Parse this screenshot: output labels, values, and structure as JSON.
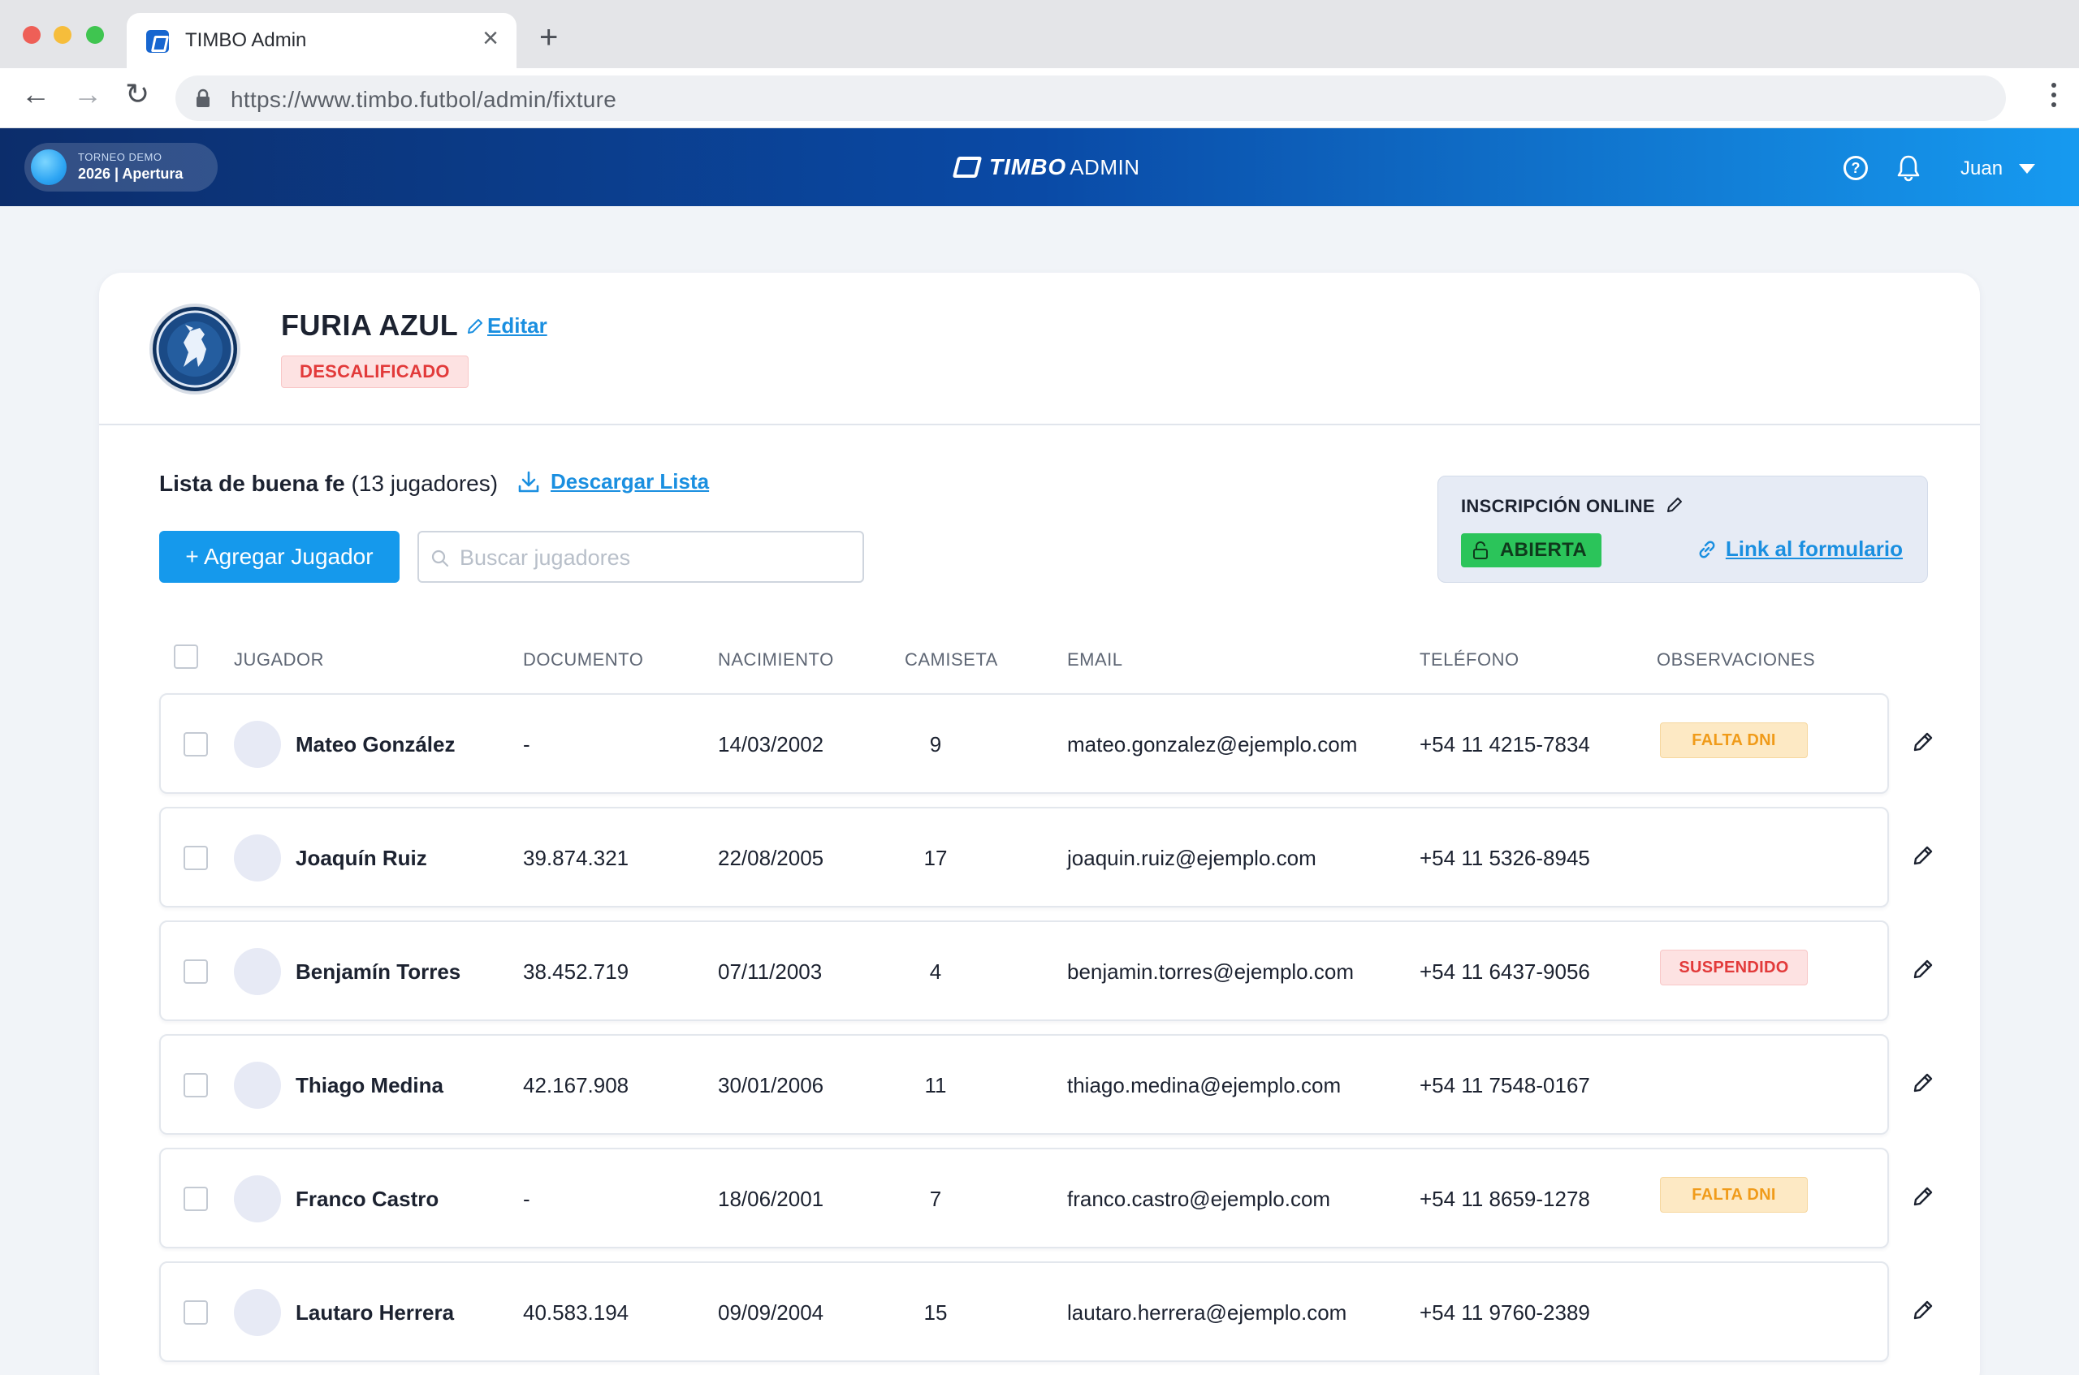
{
  "browser": {
    "tab_title": "TIMBO Admin",
    "url": "https://www.timbo.futbol/admin/fixture"
  },
  "header": {
    "season_small": "TORNEO DEMO",
    "season_main": "2026 | Apertura",
    "brand_name": "TIMBO",
    "brand_suffix": "ADMIN",
    "user_name": "Juan",
    "gradient": [
      "#0c2d6b",
      "#169af0"
    ]
  },
  "team": {
    "name": "FURIA AZUL",
    "edit_label": "Editar",
    "status": "DESCALIFICADO",
    "logo_text": "FURIA AZUL"
  },
  "list": {
    "title_bold": "Lista de buena fe",
    "title_count": "(13 jugadores)",
    "download_label": "Descargar Lista",
    "add_label": "+ Agregar Jugador",
    "search_placeholder": "Buscar jugadores"
  },
  "online": {
    "title": "INSCRIPCIÓN ONLINE",
    "state": "ABIERTA",
    "link_label": "Link al formulario"
  },
  "table": {
    "columns": [
      "JUGADOR",
      "DOCUMENTO",
      "NACIMIENTO",
      "CAMISETA",
      "EMAIL",
      "TELÉFONO",
      "OBSERVACIONES"
    ],
    "rows": [
      {
        "name": "Mateo González",
        "doc": "-",
        "birth": "14/03/2002",
        "shirt": "9",
        "email": "mateo.gonzalez@ejemplo.com",
        "phone": "+54 11 4215-7834",
        "obs": "FALTA DNI",
        "obs_type": "warning"
      },
      {
        "name": "Joaquín Ruiz",
        "doc": "39.874.321",
        "birth": "22/08/2005",
        "shirt": "17",
        "email": "joaquin.ruiz@ejemplo.com",
        "phone": "+54 11 5326-8945",
        "obs": "",
        "obs_type": ""
      },
      {
        "name": "Benjamín Torres",
        "doc": "38.452.719",
        "birth": "07/11/2003",
        "shirt": "4",
        "email": "benjamin.torres@ejemplo.com",
        "phone": "+54 11 6437-9056",
        "obs": "SUSPENDIDO",
        "obs_type": "danger"
      },
      {
        "name": "Thiago Medina",
        "doc": "42.167.908",
        "birth": "30/01/2006",
        "shirt": "11",
        "email": "thiago.medina@ejemplo.com",
        "phone": "+54 11 7548-0167",
        "obs": "",
        "obs_type": ""
      },
      {
        "name": "Franco Castro",
        "doc": "-",
        "birth": "18/06/2001",
        "shirt": "7",
        "email": "franco.castro@ejemplo.com",
        "phone": "+54 11 8659-1278",
        "obs": "FALTA DNI",
        "obs_type": "warning"
      },
      {
        "name": "Lautaro Herrera",
        "doc": "40.583.194",
        "birth": "09/09/2004",
        "shirt": "15",
        "email": "lautaro.herrera@ejemplo.com",
        "phone": "+54 11 9760-2389",
        "obs": "",
        "obs_type": ""
      }
    ]
  }
}
